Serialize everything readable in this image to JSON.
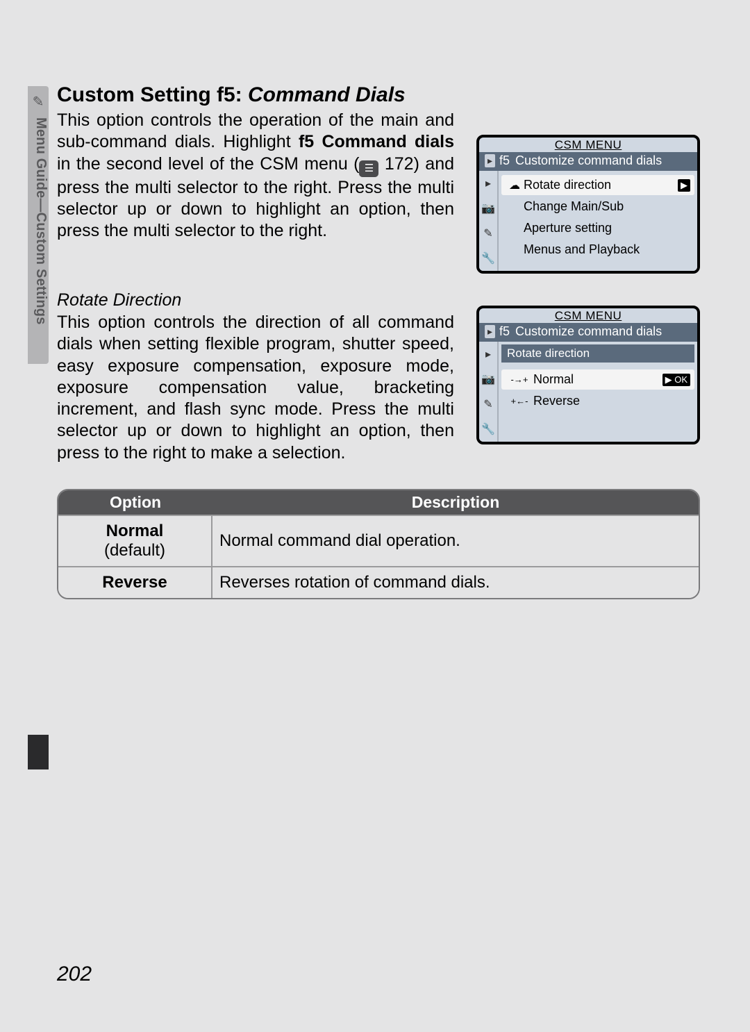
{
  "sidebar": {
    "icon": "✎",
    "label": "Menu Guide—Custom Settings"
  },
  "heading": {
    "prefix": "Custom Setting f5: ",
    "emph": "Command Dials"
  },
  "para1": {
    "t1": "This option controls the operation of the main and sub-command dials.  Highlight ",
    "bold": "f5 Command dials",
    "t2": " in the second level of the CSM menu (",
    "t3": " 172) and press the multi selector to the right.  Press the multi selector up or down to highlight an option, then press the multi selector to the right."
  },
  "lcd1": {
    "title": "CSM MENU",
    "tag": "▸",
    "code": "f5",
    "header": "Customize command dials",
    "rows": [
      {
        "icon": "☁",
        "label": "Rotate direction",
        "selected": true,
        "arrow": "▶"
      },
      {
        "icon": "",
        "label": "Change Main/Sub"
      },
      {
        "icon": "",
        "label": "Aperture setting"
      },
      {
        "icon": "",
        "label": "Menus and Playback"
      }
    ],
    "side": [
      "▸",
      "📷",
      "✎",
      "🔧"
    ]
  },
  "sub1": "Rotate Direction",
  "para2": "This option controls the direction of all command dials when setting flexible program, shutter speed, easy exposure compensation, exposure mode, exposure compensation value, bracketing increment, and flash sync mode.  Press the multi selector up or down to highlight an option, then press to the right to make a selection.",
  "lcd2": {
    "title": "CSM MENU",
    "tag": "▸",
    "code": "f5",
    "header": "Customize command dials",
    "subtitle": "Rotate direction",
    "rows": [
      {
        "icon": "-→+",
        "label": "Normal",
        "selected": true,
        "arrow": "▶",
        "ok": "OK"
      },
      {
        "icon": "+←-",
        "label": "Reverse"
      }
    ],
    "side": [
      "▸",
      "📷",
      "✎",
      "🔧"
    ]
  },
  "table": {
    "headers": {
      "option": "Option",
      "desc": "Description"
    },
    "rows": [
      {
        "name": "Normal",
        "def": "(default)",
        "desc": "Normal command dial operation."
      },
      {
        "name": "Reverse",
        "def": "",
        "desc": "Reverses rotation of command dials."
      }
    ]
  },
  "page_num": "202"
}
